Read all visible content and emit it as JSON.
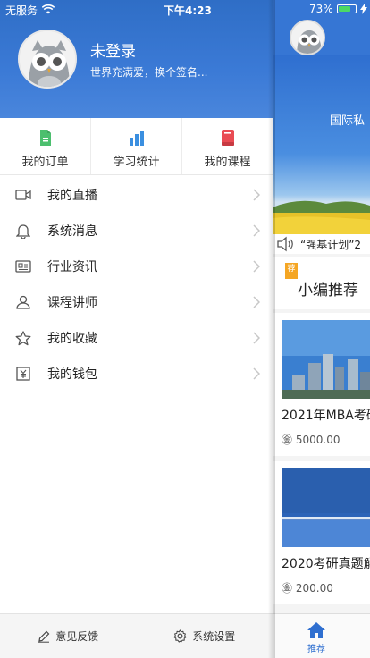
{
  "status_bar": {
    "carrier": "无服务",
    "time": "下午4:23",
    "battery": "73%",
    "battery_level": 0.73
  },
  "profile": {
    "name": "未登录",
    "signature": "世界充满爱，换个签名..."
  },
  "quick_actions": [
    {
      "label": "我的订单",
      "icon": "document-icon",
      "color": "#4cbf6e"
    },
    {
      "label": "学习统计",
      "icon": "bar-chart-icon",
      "color": "#3b8fe0"
    },
    {
      "label": "我的课程",
      "icon": "book-icon",
      "color": "#e94b53"
    }
  ],
  "menu": [
    {
      "label": "我的直播",
      "icon": "video-camera-icon"
    },
    {
      "label": "系统消息",
      "icon": "bell-icon"
    },
    {
      "label": "行业资讯",
      "icon": "news-icon"
    },
    {
      "label": "课程讲师",
      "icon": "person-icon"
    },
    {
      "label": "我的收藏",
      "icon": "star-icon"
    },
    {
      "label": "我的钱包",
      "icon": "wallet-icon"
    }
  ],
  "footer": {
    "feedback": "意见反馈",
    "settings": "系统设置"
  },
  "main": {
    "banner_text": "国际私",
    "notice": "“强基计划”2",
    "recommend_tag": "荐",
    "section_title": "小编推荐",
    "courses": [
      {
        "title": "2021年MBA考研",
        "price": "5000.00"
      },
      {
        "title": "2020考研真题解",
        "price": "200.00"
      }
    ],
    "tab_home": "推荐"
  },
  "colors": {
    "brand_blue": "#3676d4",
    "accent_orange": "#f5a623"
  }
}
